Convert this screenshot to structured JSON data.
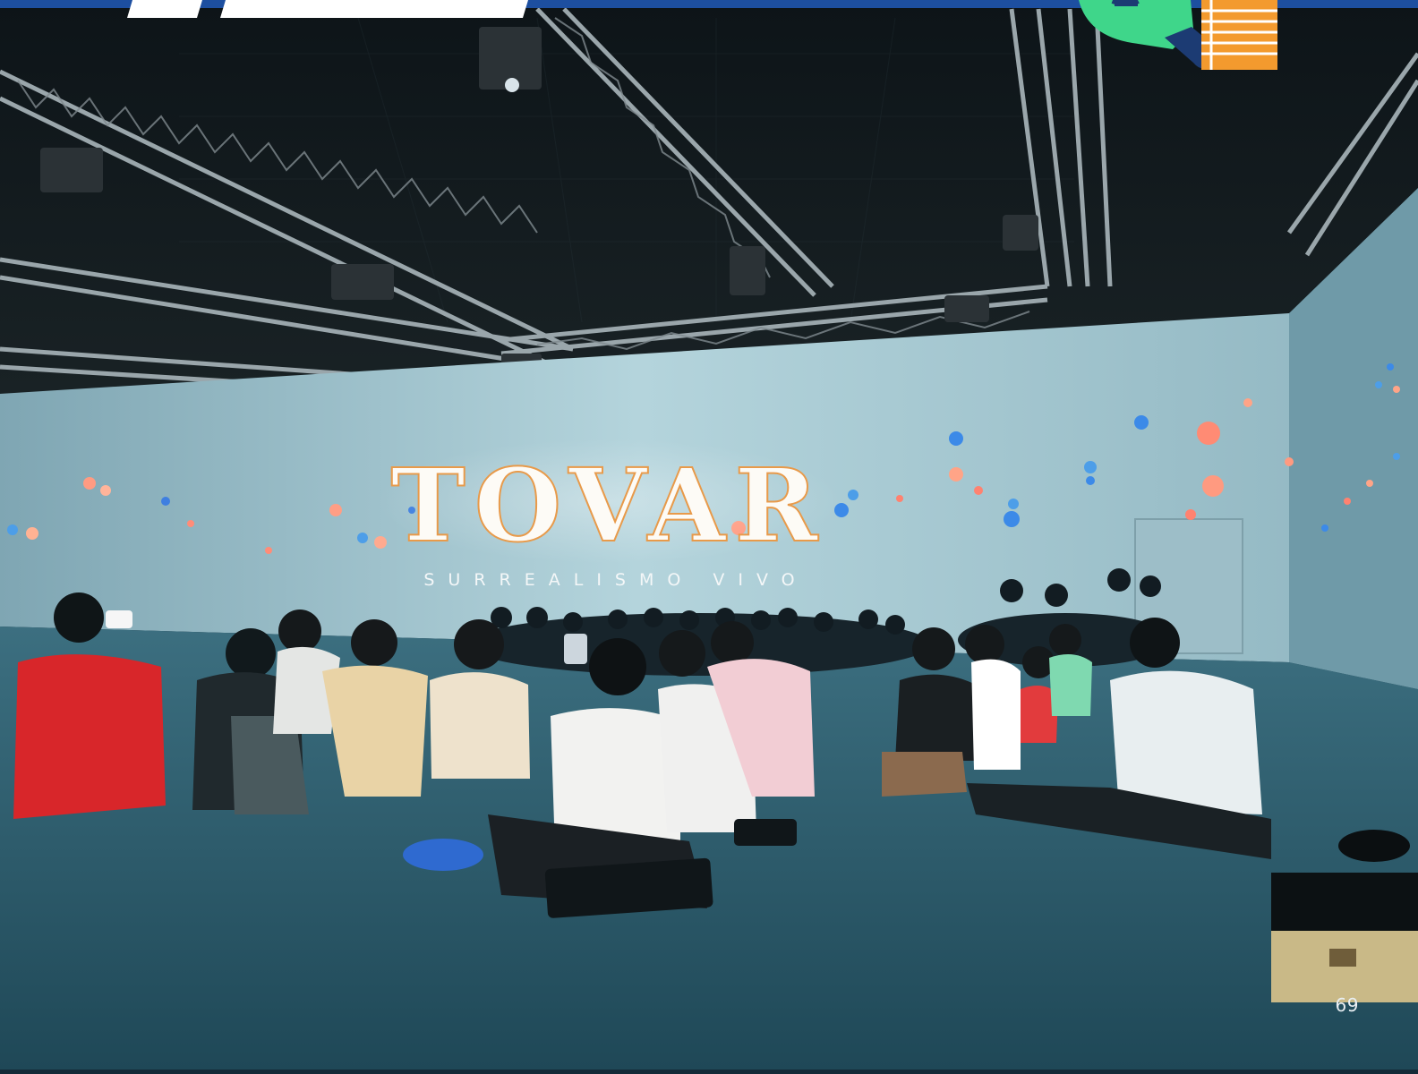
{
  "page": {
    "number": "69"
  },
  "photo": {
    "projection_title": "TOVAR",
    "projection_subtitle": "SURREALISMO VIVO"
  },
  "colors": {
    "header_band": "#1d4fa0",
    "logo_green": "#3fd68a",
    "logo_navy": "#1c3b73",
    "logo_orange": "#f39a2e",
    "projection_wall": "#a9cdd6",
    "floor": "#2a5666"
  },
  "icons": [
    "money-search-icon",
    "ledger-icon"
  ]
}
